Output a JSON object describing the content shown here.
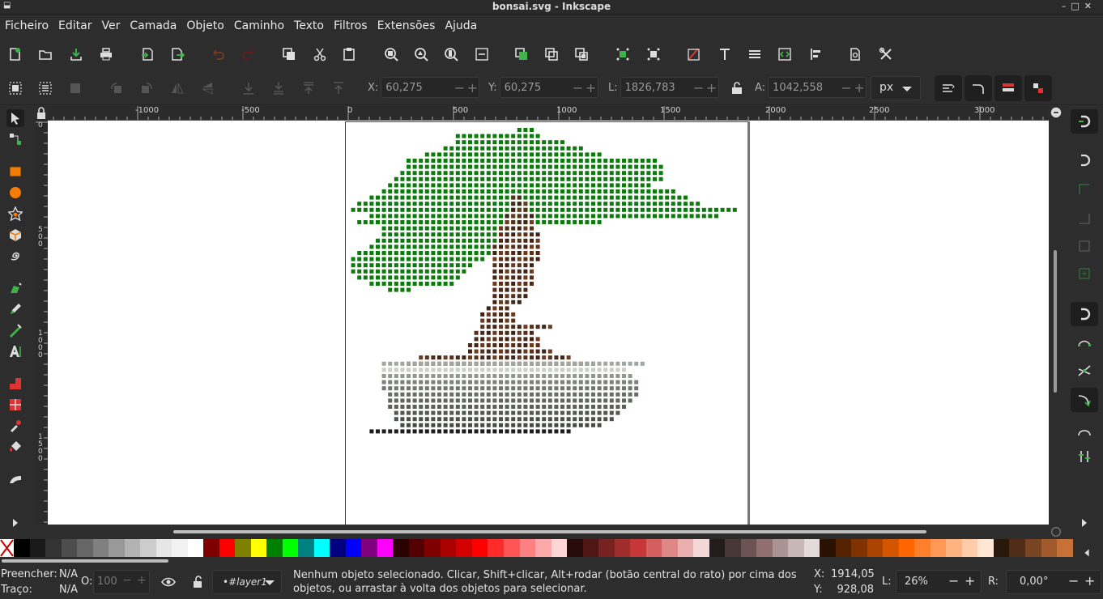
{
  "window": {
    "title": "bonsai.svg - Inkscape"
  },
  "menu": [
    "Ficheiro",
    "Editar",
    "Ver",
    "Camada",
    "Objeto",
    "Caminho",
    "Texto",
    "Filtros",
    "Extensões",
    "Ajuda"
  ],
  "commands": [
    "new-document-icon",
    "open-icon",
    "save-icon",
    "print-icon",
    "import-icon",
    "export-icon",
    "undo-icon",
    "redo-icon",
    "duplicate-icon",
    "cut-icon",
    "paste-icon",
    "zoom-selection-icon",
    "zoom-drawing-icon",
    "zoom-page-icon",
    "zoom-page-width-icon",
    "group-icon",
    "ungroup-icon",
    "clone-icon",
    "align-icon",
    "distribute-icon",
    "fill-stroke-icon",
    "text-font-icon",
    "layers-icon",
    "xml-editor-icon",
    "align-distribute-icon",
    "document-properties-icon",
    "preferences-icon"
  ],
  "selector": {
    "x": {
      "label": "X:",
      "value": "60,275"
    },
    "y": {
      "label": "Y:",
      "value": "60,275"
    },
    "w": {
      "label": "L:",
      "value": "1826,783"
    },
    "h": {
      "label": "A:",
      "value": "1042,558"
    },
    "unit": "px"
  },
  "ruler": {
    "h_ticks": [
      "-1000",
      "-500",
      "0",
      "500",
      "1000",
      "1500",
      "2000",
      "2500",
      "3000"
    ],
    "v_ticks": [
      "0",
      "5\n0\n0",
      "1\n0\n0\n0",
      "1\n5\n0\n0"
    ]
  },
  "tools": [
    "selector-tool-icon",
    "node-tool-icon",
    "rectangle-tool-icon",
    "ellipse-tool-icon",
    "star-tool-icon",
    "3d-box-tool-icon",
    "spiral-tool-icon",
    "pen-tool-icon",
    "pencil-tool-icon",
    "calligraphy-tool-icon",
    "text-tool-icon",
    "gradient-tool-icon",
    "mesh-tool-icon",
    "dropper-tool-icon",
    "paint-bucket-tool-icon",
    "tweak-tool-icon"
  ],
  "palette": [
    "#000000",
    "#1a1a1a",
    "#333333",
    "#4d4d4d",
    "#666666",
    "#808080",
    "#999999",
    "#b3b3b3",
    "#cccccc",
    "#e6e6e6",
    "#f2f2f2",
    "#ffffff",
    "#800000",
    "#ff0000",
    "#808000",
    "#ffff00",
    "#008000",
    "#00ff00",
    "#008080",
    "#00ffff",
    "#000080",
    "#0000ff",
    "#800080",
    "#ff00ff",
    "#2b0000",
    "#550000",
    "#800000",
    "#aa0000",
    "#d40000",
    "#ff0000",
    "#ff2a2a",
    "#ff5555",
    "#ff8080",
    "#ffaaaa",
    "#ffd5d5",
    "#280b0b",
    "#501616",
    "#782121",
    "#a02c2c",
    "#c83737",
    "#d35f5f",
    "#de8787",
    "#e9afaf",
    "#f4d7d7",
    "#241c1c",
    "#483737",
    "#6c5353",
    "#916f6f",
    "#ac9393",
    "#c8b7b7",
    "#e3dbdb",
    "#2b1100",
    "#552200",
    "#803300",
    "#aa4400",
    "#d45500",
    "#ff6600",
    "#ff7f2a",
    "#ff9955",
    "#ffb380",
    "#ffccaa",
    "#ffe6d5",
    "#28170b",
    "#502d16",
    "#784421",
    "#a05a2c",
    "#c87137"
  ],
  "status": {
    "fill_label": "Preencher:",
    "fill_value": "N/A",
    "stroke_label": "Traço:",
    "stroke_value": "N/A",
    "opacity_label": "O:",
    "opacity_value": "100",
    "layer": "•#layer1",
    "message": "Nenhum objeto selecionado. Clicar, Shift+clicar, Alt+rodar (botão central do rato) por cima dos objetos, ou arrastar à volta dos objetos para selecionar.",
    "cursor_x_label": "X:",
    "cursor_x": "1914,05",
    "cursor_y_label": "Y:",
    "cursor_y": "928,08",
    "zoom_label": "L:",
    "zoom": "26%",
    "rotate_label": "R:",
    "rotate": "0,00°"
  }
}
